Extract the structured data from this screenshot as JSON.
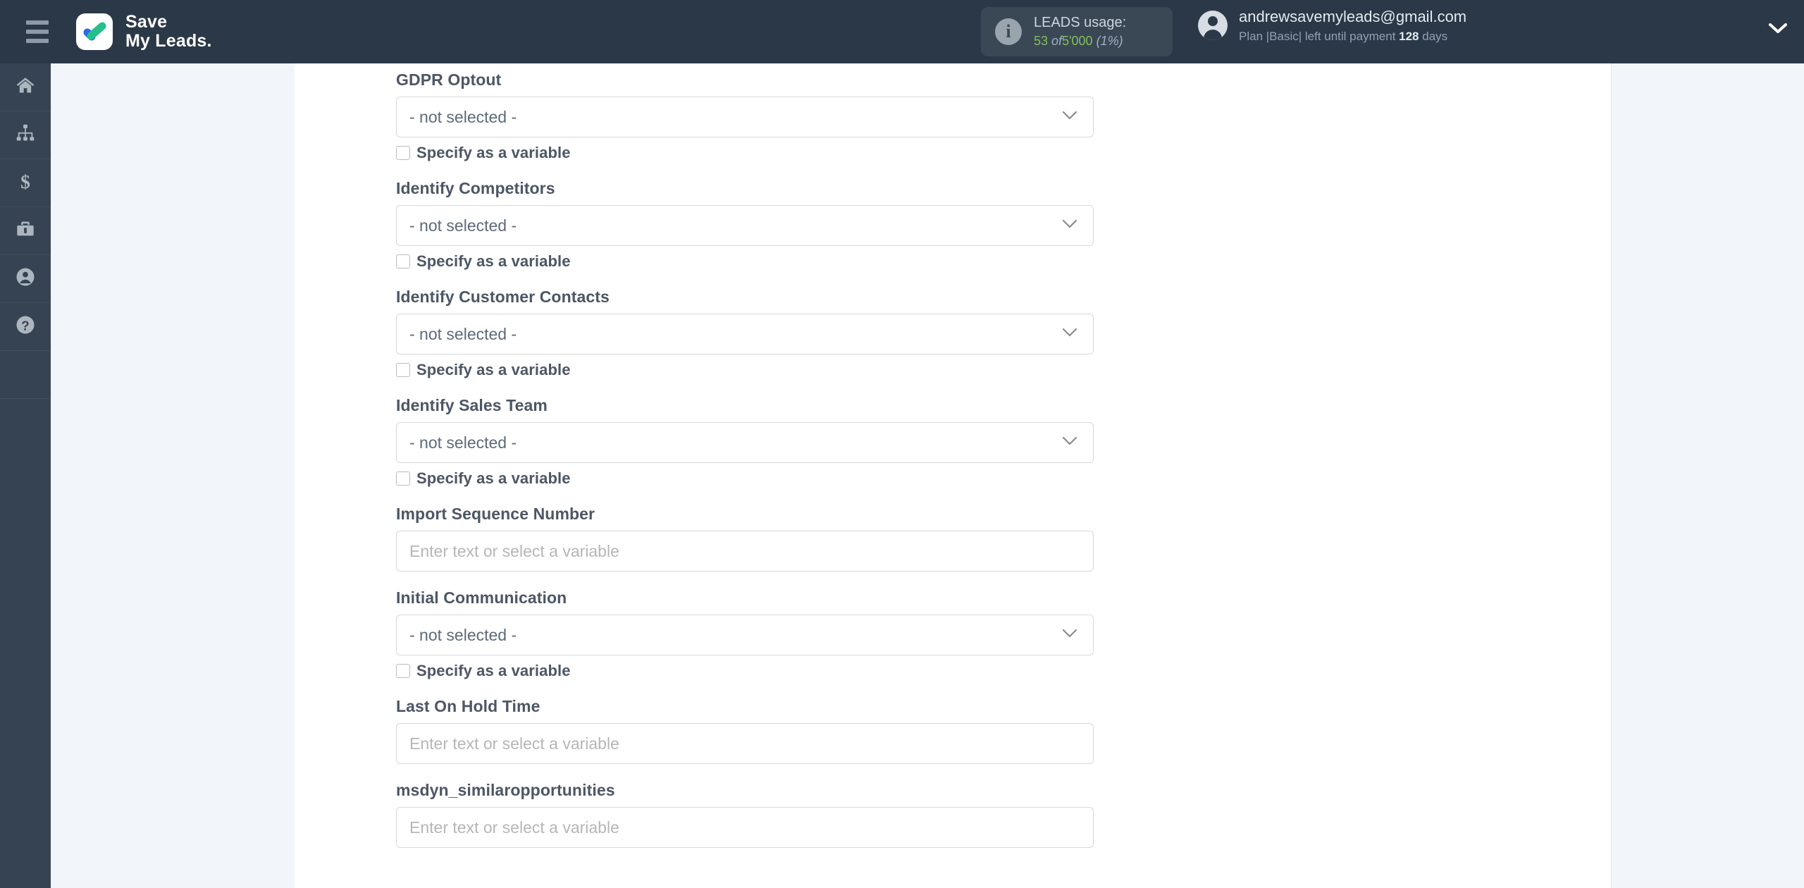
{
  "header": {
    "menu_icon": "hamburger-icon",
    "brand_line1": "Save",
    "brand_line2": "My Leads.",
    "logo_icon": "checkmark-logo-icon",
    "usage": {
      "info_icon": "info-icon",
      "title": "LEADS usage:",
      "used": "53",
      "of": "of",
      "total": "5'000",
      "percent": "(1%)"
    },
    "account": {
      "avatar_icon": "user-avatar-icon",
      "email": "andrewsavemyleads@gmail.com",
      "plan_prefix": "Plan |Basic| left until payment",
      "days_value": "128",
      "days_suffix": "days",
      "caret_icon": "chevron-down-icon"
    }
  },
  "sidebar": {
    "items": [
      {
        "name": "home",
        "icon": "home-icon"
      },
      {
        "name": "connections",
        "icon": "sitemap-icon"
      },
      {
        "name": "billing",
        "icon": "dollar-icon"
      },
      {
        "name": "services",
        "icon": "briefcase-icon"
      },
      {
        "name": "profile",
        "icon": "user-circle-icon"
      },
      {
        "name": "help",
        "icon": "question-circle-icon"
      }
    ]
  },
  "form": {
    "select_value": "- not selected -",
    "input_placeholder": "Enter text or select a variable",
    "variable_checkbox_label": "Specify as a variable",
    "dropdown_icon": "chevron-down-icon",
    "fields": [
      {
        "label": "GDPR Optout",
        "type": "select",
        "has_variable_checkbox": true,
        "checked": false
      },
      {
        "label": "Identify Competitors",
        "type": "select",
        "has_variable_checkbox": true,
        "checked": false
      },
      {
        "label": "Identify Customer Contacts",
        "type": "select",
        "has_variable_checkbox": true,
        "checked": false
      },
      {
        "label": "Identify Sales Team",
        "type": "select",
        "has_variable_checkbox": true,
        "checked": false
      },
      {
        "label": "Import Sequence Number",
        "type": "text",
        "has_variable_checkbox": false,
        "checked": false
      },
      {
        "label": "Initial Communication",
        "type": "select",
        "has_variable_checkbox": true,
        "checked": false
      },
      {
        "label": "Last On Hold Time",
        "type": "text",
        "has_variable_checkbox": false,
        "checked": false
      },
      {
        "label": "msdyn_similaropportunities",
        "type": "text",
        "has_variable_checkbox": false,
        "checked": false
      }
    ]
  },
  "colors": {
    "header_bg": "#2b3847",
    "rail_bg": "#354353",
    "canvas_bg": "#f2f5fa",
    "panel_bg": "#ffffff",
    "accent_green": "#84bf5a",
    "label_text": "#4d5664"
  }
}
